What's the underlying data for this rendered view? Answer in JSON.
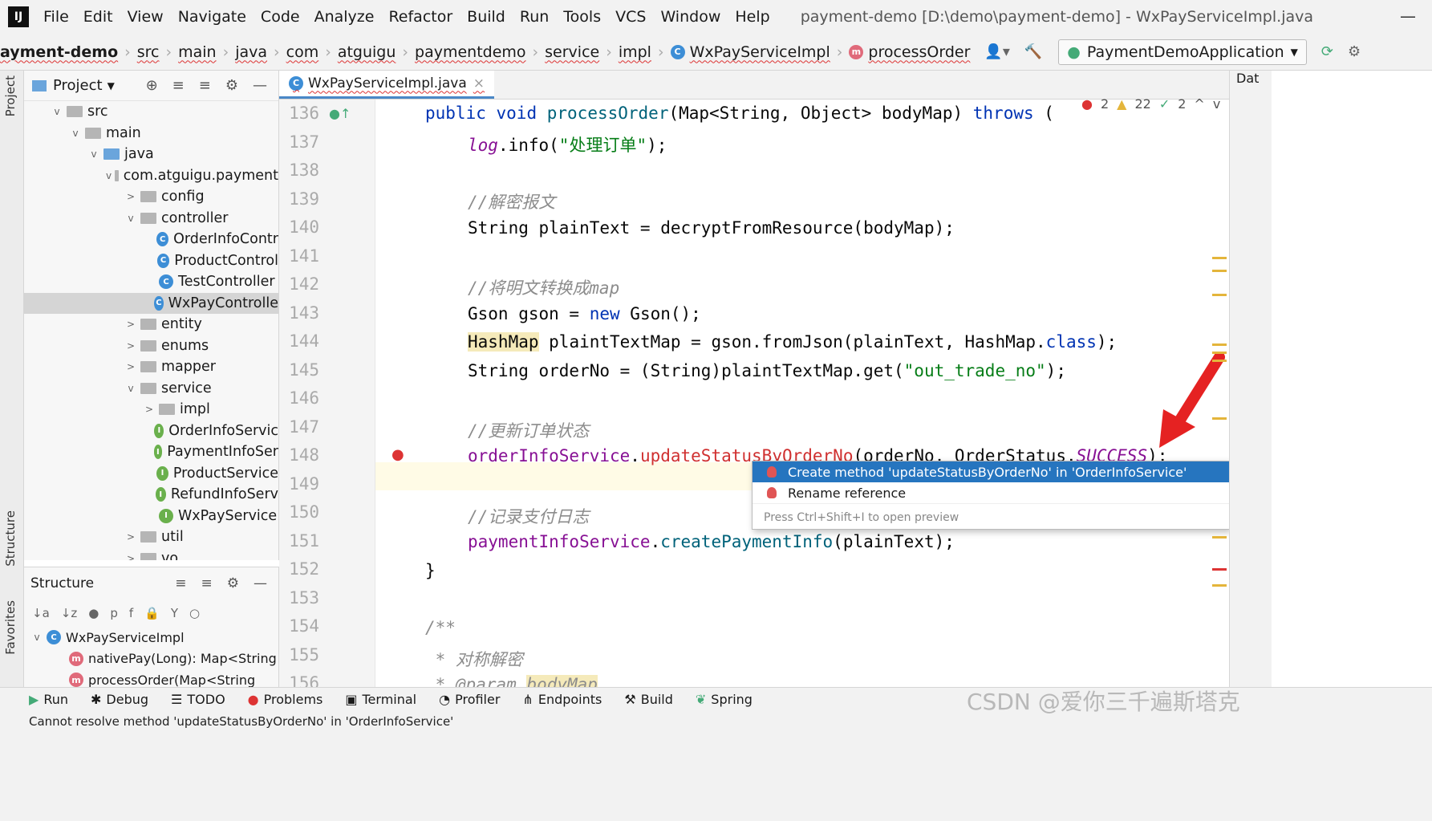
{
  "menu": {
    "items": [
      "File",
      "Edit",
      "View",
      "Navigate",
      "Code",
      "Analyze",
      "Refactor",
      "Build",
      "Run",
      "Tools",
      "VCS",
      "Window",
      "Help"
    ],
    "title": "payment-demo [D:\\demo\\payment-demo] - WxPayServiceImpl.java"
  },
  "breadcrumb": {
    "items": [
      "ayment-demo",
      "src",
      "main",
      "java",
      "com",
      "atguigu",
      "paymentdemo",
      "service",
      "impl",
      "WxPayServiceImpl",
      "processOrder"
    ],
    "run_config": "PaymentDemoApplication"
  },
  "project": {
    "header": "Project",
    "tree": [
      {
        "label": "src",
        "depth": 1,
        "type": "folder",
        "arrow": "v"
      },
      {
        "label": "main",
        "depth": 2,
        "type": "folder",
        "arrow": "v"
      },
      {
        "label": "java",
        "depth": 3,
        "type": "folder-blue",
        "arrow": "v"
      },
      {
        "label": "com.atguigu.payment",
        "depth": 4,
        "type": "folder",
        "arrow": "v"
      },
      {
        "label": "config",
        "depth": 5,
        "type": "folder",
        "arrow": ">"
      },
      {
        "label": "controller",
        "depth": 5,
        "type": "folder",
        "arrow": "v"
      },
      {
        "label": "OrderInfoContr",
        "depth": 6,
        "type": "class",
        "arrow": ""
      },
      {
        "label": "ProductControl",
        "depth": 6,
        "type": "class",
        "arrow": ""
      },
      {
        "label": "TestController",
        "depth": 6,
        "type": "class",
        "arrow": ""
      },
      {
        "label": "WxPayControlle",
        "depth": 6,
        "type": "class",
        "arrow": "",
        "selected": true
      },
      {
        "label": "entity",
        "depth": 5,
        "type": "folder",
        "arrow": ">"
      },
      {
        "label": "enums",
        "depth": 5,
        "type": "folder",
        "arrow": ">"
      },
      {
        "label": "mapper",
        "depth": 5,
        "type": "folder",
        "arrow": ">"
      },
      {
        "label": "service",
        "depth": 5,
        "type": "folder",
        "arrow": "v"
      },
      {
        "label": "impl",
        "depth": 6,
        "type": "folder",
        "arrow": ">"
      },
      {
        "label": "OrderInfoServic",
        "depth": 6,
        "type": "interface",
        "arrow": ""
      },
      {
        "label": "PaymentInfoSer",
        "depth": 6,
        "type": "interface",
        "arrow": ""
      },
      {
        "label": "ProductService",
        "depth": 6,
        "type": "interface",
        "arrow": ""
      },
      {
        "label": "RefundInfoServ",
        "depth": 6,
        "type": "interface",
        "arrow": ""
      },
      {
        "label": "WxPayService",
        "depth": 6,
        "type": "interface",
        "arrow": ""
      },
      {
        "label": "util",
        "depth": 5,
        "type": "folder",
        "arrow": ">"
      },
      {
        "label": "vo",
        "depth": 5,
        "type": "folder",
        "arrow": ">"
      },
      {
        "label": "PaymentDemoApp",
        "depth": 5,
        "type": "class",
        "arrow": ""
      }
    ]
  },
  "structure": {
    "header": "Structure",
    "items": [
      "WxPayServiceImpl",
      "nativePay(Long): Map<String",
      "processOrder(Map<String"
    ]
  },
  "editor": {
    "tab": "WxPayServiceImpl.java",
    "inspections": {
      "errors": "2",
      "warnings": "22",
      "ok": "2"
    },
    "line_numbers": [
      "136",
      "137",
      "138",
      "139",
      "140",
      "141",
      "142",
      "143",
      "144",
      "145",
      "146",
      "147",
      "148",
      "149",
      "150",
      "151",
      "152",
      "153",
      "154",
      "155",
      "156"
    ]
  },
  "popup": {
    "items": [
      "Create method 'updateStatusByOrderNo' in 'OrderInfoService'",
      "Rename reference"
    ],
    "hint": "Press Ctrl+Shift+I to open preview"
  },
  "bottom": {
    "tools": [
      "Run",
      "Debug",
      "TODO",
      "Problems",
      "Terminal",
      "Profiler",
      "Endpoints",
      "Build",
      "Spring"
    ]
  },
  "status": {
    "text": "Cannot resolve method 'updateStatusByOrderNo' in 'OrderInfoService'"
  },
  "sidebar": {
    "left_tabs": [
      "Project",
      "Structure",
      "Favorites"
    ],
    "right_tab": "Dat"
  },
  "watermark": "CSDN @爱你三千遍斯塔克"
}
